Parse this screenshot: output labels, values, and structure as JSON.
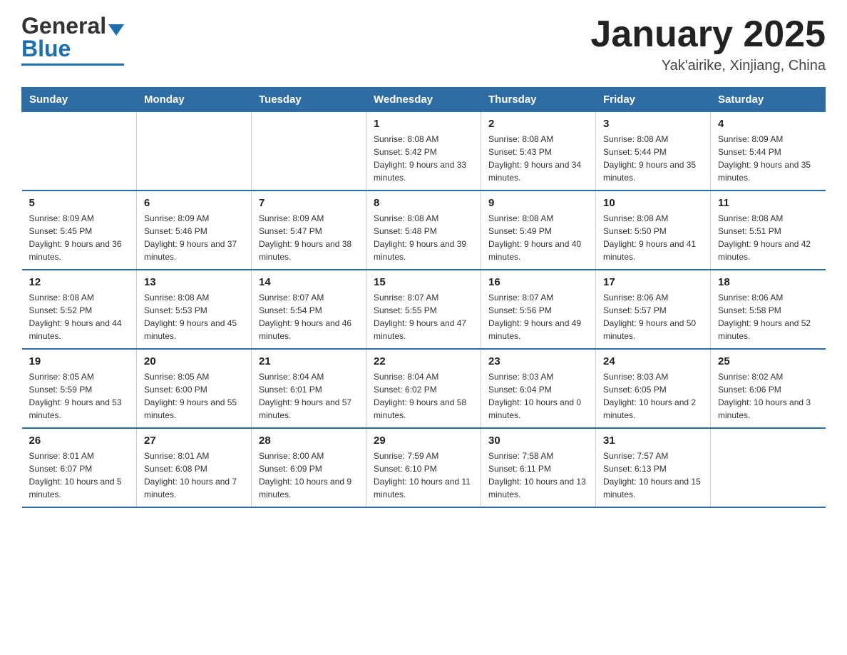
{
  "logo": {
    "text_black": "General",
    "text_blue": "Blue"
  },
  "title": "January 2025",
  "subtitle": "Yak'airike, Xinjiang, China",
  "days_of_week": [
    "Sunday",
    "Monday",
    "Tuesday",
    "Wednesday",
    "Thursday",
    "Friday",
    "Saturday"
  ],
  "weeks": [
    [
      {
        "day": "",
        "info": ""
      },
      {
        "day": "",
        "info": ""
      },
      {
        "day": "",
        "info": ""
      },
      {
        "day": "1",
        "info": "Sunrise: 8:08 AM\nSunset: 5:42 PM\nDaylight: 9 hours and 33 minutes."
      },
      {
        "day": "2",
        "info": "Sunrise: 8:08 AM\nSunset: 5:43 PM\nDaylight: 9 hours and 34 minutes."
      },
      {
        "day": "3",
        "info": "Sunrise: 8:08 AM\nSunset: 5:44 PM\nDaylight: 9 hours and 35 minutes."
      },
      {
        "day": "4",
        "info": "Sunrise: 8:09 AM\nSunset: 5:44 PM\nDaylight: 9 hours and 35 minutes."
      }
    ],
    [
      {
        "day": "5",
        "info": "Sunrise: 8:09 AM\nSunset: 5:45 PM\nDaylight: 9 hours and 36 minutes."
      },
      {
        "day": "6",
        "info": "Sunrise: 8:09 AM\nSunset: 5:46 PM\nDaylight: 9 hours and 37 minutes."
      },
      {
        "day": "7",
        "info": "Sunrise: 8:09 AM\nSunset: 5:47 PM\nDaylight: 9 hours and 38 minutes."
      },
      {
        "day": "8",
        "info": "Sunrise: 8:08 AM\nSunset: 5:48 PM\nDaylight: 9 hours and 39 minutes."
      },
      {
        "day": "9",
        "info": "Sunrise: 8:08 AM\nSunset: 5:49 PM\nDaylight: 9 hours and 40 minutes."
      },
      {
        "day": "10",
        "info": "Sunrise: 8:08 AM\nSunset: 5:50 PM\nDaylight: 9 hours and 41 minutes."
      },
      {
        "day": "11",
        "info": "Sunrise: 8:08 AM\nSunset: 5:51 PM\nDaylight: 9 hours and 42 minutes."
      }
    ],
    [
      {
        "day": "12",
        "info": "Sunrise: 8:08 AM\nSunset: 5:52 PM\nDaylight: 9 hours and 44 minutes."
      },
      {
        "day": "13",
        "info": "Sunrise: 8:08 AM\nSunset: 5:53 PM\nDaylight: 9 hours and 45 minutes."
      },
      {
        "day": "14",
        "info": "Sunrise: 8:07 AM\nSunset: 5:54 PM\nDaylight: 9 hours and 46 minutes."
      },
      {
        "day": "15",
        "info": "Sunrise: 8:07 AM\nSunset: 5:55 PM\nDaylight: 9 hours and 47 minutes."
      },
      {
        "day": "16",
        "info": "Sunrise: 8:07 AM\nSunset: 5:56 PM\nDaylight: 9 hours and 49 minutes."
      },
      {
        "day": "17",
        "info": "Sunrise: 8:06 AM\nSunset: 5:57 PM\nDaylight: 9 hours and 50 minutes."
      },
      {
        "day": "18",
        "info": "Sunrise: 8:06 AM\nSunset: 5:58 PM\nDaylight: 9 hours and 52 minutes."
      }
    ],
    [
      {
        "day": "19",
        "info": "Sunrise: 8:05 AM\nSunset: 5:59 PM\nDaylight: 9 hours and 53 minutes."
      },
      {
        "day": "20",
        "info": "Sunrise: 8:05 AM\nSunset: 6:00 PM\nDaylight: 9 hours and 55 minutes."
      },
      {
        "day": "21",
        "info": "Sunrise: 8:04 AM\nSunset: 6:01 PM\nDaylight: 9 hours and 57 minutes."
      },
      {
        "day": "22",
        "info": "Sunrise: 8:04 AM\nSunset: 6:02 PM\nDaylight: 9 hours and 58 minutes."
      },
      {
        "day": "23",
        "info": "Sunrise: 8:03 AM\nSunset: 6:04 PM\nDaylight: 10 hours and 0 minutes."
      },
      {
        "day": "24",
        "info": "Sunrise: 8:03 AM\nSunset: 6:05 PM\nDaylight: 10 hours and 2 minutes."
      },
      {
        "day": "25",
        "info": "Sunrise: 8:02 AM\nSunset: 6:06 PM\nDaylight: 10 hours and 3 minutes."
      }
    ],
    [
      {
        "day": "26",
        "info": "Sunrise: 8:01 AM\nSunset: 6:07 PM\nDaylight: 10 hours and 5 minutes."
      },
      {
        "day": "27",
        "info": "Sunrise: 8:01 AM\nSunset: 6:08 PM\nDaylight: 10 hours and 7 minutes."
      },
      {
        "day": "28",
        "info": "Sunrise: 8:00 AM\nSunset: 6:09 PM\nDaylight: 10 hours and 9 minutes."
      },
      {
        "day": "29",
        "info": "Sunrise: 7:59 AM\nSunset: 6:10 PM\nDaylight: 10 hours and 11 minutes."
      },
      {
        "day": "30",
        "info": "Sunrise: 7:58 AM\nSunset: 6:11 PM\nDaylight: 10 hours and 13 minutes."
      },
      {
        "day": "31",
        "info": "Sunrise: 7:57 AM\nSunset: 6:13 PM\nDaylight: 10 hours and 15 minutes."
      },
      {
        "day": "",
        "info": ""
      }
    ]
  ]
}
